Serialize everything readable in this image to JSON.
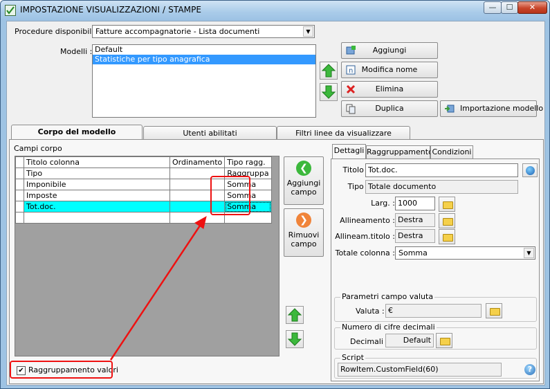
{
  "window": {
    "title": "IMPOSTAZIONE VISUALIZZAZIONI / STAMPE",
    "minimize": "—",
    "maximize": "☐",
    "close": "✕"
  },
  "procedure": {
    "label": "Procedure disponibili :",
    "value": "Fatture accompagnatorie - Lista documenti"
  },
  "modelli": {
    "label": "Modelli :",
    "items": [
      "Default",
      "Statistiche per tipo anagrafica"
    ],
    "selected_index": 1
  },
  "buttons": {
    "aggiungi": "Aggiungi",
    "modifica": "Modifica nome",
    "elimina": "Elimina",
    "duplica": "Duplica",
    "importazione": "Importazione modello"
  },
  "tabs": [
    "Corpo del modello",
    "Utenti abilitati",
    "Filtri linee da visualizzare"
  ],
  "campi": {
    "label": "Campi corpo",
    "headers": [
      "Titolo colonna",
      "Ordinamento",
      "Tipo ragg."
    ],
    "rows": [
      {
        "titolo": "Tipo",
        "ordinamento": "",
        "tipo": "Raggruppa"
      },
      {
        "titolo": "Imponibile",
        "ordinamento": "",
        "tipo": "Somma"
      },
      {
        "titolo": "Imposte",
        "ordinamento": "",
        "tipo": "Somma"
      },
      {
        "titolo": "Tot.doc.",
        "ordinamento": "",
        "tipo": "Somma"
      },
      {
        "titolo": "",
        "ordinamento": "",
        "tipo": ""
      }
    ],
    "selected_row": 3
  },
  "field_buttons": {
    "aggiungi_line1": "Aggiungi",
    "aggiungi_line2": "campo",
    "rimuovi_line1": "Rimuovi",
    "rimuovi_line2": "campo"
  },
  "raggruppamento": {
    "label": "Raggruppamento valori",
    "checked": true
  },
  "detail_tabs": [
    "Dettagli",
    "Raggruppamento",
    "Condizioni"
  ],
  "dettagli": {
    "titolo_label": "Titolo :",
    "titolo_value": "Tot.doc.",
    "tipo_label": "Tipo :",
    "tipo_value": "Totale documento",
    "larg_label": "Larg. :",
    "larg_value": "1000",
    "allineamento_label": "Allineamento :",
    "allineamento_value": "Destra",
    "allineam_titolo_label": "Allineam.titolo :",
    "allineam_titolo_value": "Destra",
    "totale_label": "Totale colonna :",
    "totale_value": "Somma"
  },
  "valuta": {
    "group": "Parametri campo valuta",
    "label": "Valuta :",
    "value": "€"
  },
  "decimali": {
    "group": "Numero di cifre decimali",
    "label": "Decimali :",
    "value": "Default"
  },
  "script": {
    "group": "Script",
    "value": "RowItem.CustomField(60)"
  },
  "colors": {
    "highlight_row": "#00ffff",
    "selection": "#3399ff",
    "annotation": "#ee1111"
  }
}
